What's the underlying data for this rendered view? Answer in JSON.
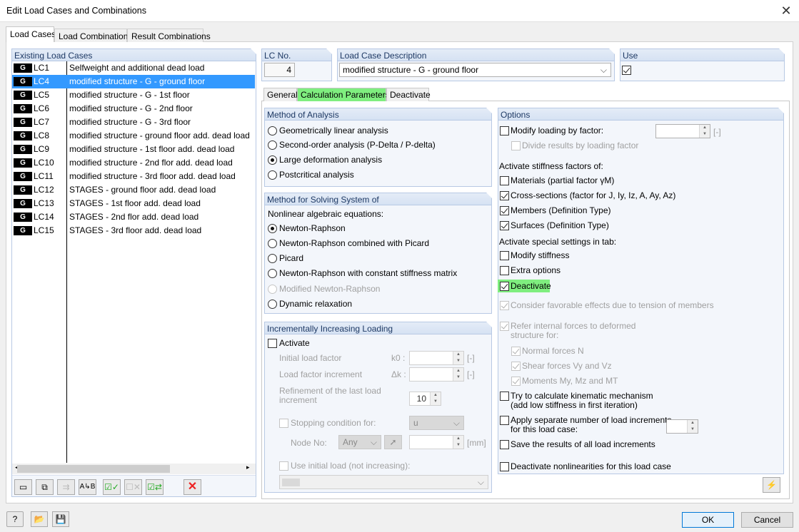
{
  "window": {
    "title": "Edit Load Cases and Combinations",
    "close": "✕"
  },
  "tabs": [
    {
      "label": "Load Cases",
      "selected": true
    },
    {
      "label": "Load Combinations"
    },
    {
      "label": "Result Combinations"
    }
  ],
  "existing": {
    "header": "Existing Load Cases",
    "items": [
      {
        "type": "G",
        "id": "LC1",
        "desc": "Selfweight and additional dead load"
      },
      {
        "type": "G",
        "id": "LC4",
        "desc": "modified structure - G - ground floor",
        "selected": true
      },
      {
        "type": "G",
        "id": "LC5",
        "desc": "modified structure - G - 1st floor"
      },
      {
        "type": "G",
        "id": "LC6",
        "desc": "modified structure - G - 2nd floor"
      },
      {
        "type": "G",
        "id": "LC7",
        "desc": "modified structure - G - 3rd floor"
      },
      {
        "type": "G",
        "id": "LC8",
        "desc": "modified structure - ground floor add. dead load"
      },
      {
        "type": "G",
        "id": "LC9",
        "desc": "modified structure - 1st floor add. dead load"
      },
      {
        "type": "G",
        "id": "LC10",
        "desc": "modified structure - 2nd flor add. dead load"
      },
      {
        "type": "G",
        "id": "LC11",
        "desc": "modified structure - 3rd floor add. dead load"
      },
      {
        "type": "G",
        "id": "LC12",
        "desc": "STAGES  - ground floor add. dead load"
      },
      {
        "type": "G",
        "id": "LC13",
        "desc": "STAGES - 1st floor add. dead load"
      },
      {
        "type": "G",
        "id": "LC14",
        "desc": "STAGES - 2nd flor add. dead load"
      },
      {
        "type": "G",
        "id": "LC15",
        "desc": "STAGES - 3rd floor add. dead load"
      }
    ],
    "toolbar": [
      "new-load-case-icon",
      "copy-load-case-icon",
      "renumber-icon",
      "rename-icon",
      "check-all-icon",
      "uncheck-all-icon",
      "toggle-check-icon",
      "delete-icon"
    ]
  },
  "lcno": {
    "label": "LC No.",
    "value": "4"
  },
  "lcdesc": {
    "label": "Load Case Description",
    "value": "modified structure - G - ground floor"
  },
  "use": {
    "label": "Use",
    "checked": true
  },
  "subtabs": [
    {
      "label": "General"
    },
    {
      "label": "Calculation Parameters",
      "selected": true
    },
    {
      "label": "Deactivate"
    }
  ],
  "analysis": {
    "header": "Method of Analysis",
    "options": [
      {
        "label": "Geometrically linear analysis",
        "on": false
      },
      {
        "label": "Second-order analysis (P-Delta / P-delta)",
        "on": false
      },
      {
        "label": "Large deformation analysis",
        "on": true
      },
      {
        "label": "Postcritical analysis",
        "on": false
      }
    ]
  },
  "solving": {
    "header": "Method for Solving System of",
    "sub": "Nonlinear algebraic equations:",
    "options": [
      {
        "label": "Newton-Raphson",
        "on": true
      },
      {
        "label": "Newton-Raphson combined with Picard",
        "on": false
      },
      {
        "label": "Picard",
        "on": false
      },
      {
        "label": "Newton-Raphson with constant stiffness matrix",
        "on": false
      },
      {
        "label": "Modified Newton-Raphson",
        "on": false,
        "disabled": true
      },
      {
        "label": "Dynamic relaxation",
        "on": false
      }
    ]
  },
  "incremental": {
    "header": "Incrementally Increasing Loading",
    "activate": "Activate",
    "activate_on": false,
    "initial_label": "Initial load factor",
    "initial_sym": "k0 :",
    "initial_unit": "[-]",
    "increment_label": "Load factor increment",
    "increment_sym": "Δk :",
    "increment_unit": "[-]",
    "refine_label1": "Refinement of the last load",
    "refine_label2": "increment",
    "refine_value": "10",
    "stopping_label": "Stopping condition for:",
    "stopping_value": "u",
    "node_label": "Node No:",
    "node_value": "Any",
    "node_unit": "[mm]",
    "initial_load_label": "Use initial load (not increasing):"
  },
  "options": {
    "header": "Options",
    "modify_factor": "Modify loading by factor:",
    "modify_factor_unit": "[-]",
    "divide": "Divide results by loading factor",
    "stiff_head": "Activate stiffness factors of:",
    "materials": "Materials (partial factor γM)",
    "cross": "Cross-sections (factor for J, Iy, Iz, A, Ay, Az)",
    "members": "Members (Definition Type)",
    "surfaces": "Surfaces (Definition Type)",
    "special_head": "Activate special settings in tab:",
    "modify_stiffness": "Modify stiffness",
    "extra": "Extra options",
    "deactivate": "Deactivate",
    "favorable": "Consider favorable effects due to tension of members",
    "refer1": "Refer internal forces to deformed",
    "refer2": "structure for:",
    "normal": "Normal forces N",
    "shear": "Shear forces Vy and Vz",
    "moments": "Moments My, Mz and MT",
    "kin1": "Try to calculate kinematic mechanism",
    "kin2": "(add low stiffness in first iteration)",
    "apply1": "Apply separate number of load increments",
    "apply2": "for this load case:",
    "save": "Save the results of all load increments",
    "nonlin": "Deactivate nonlinearities for this load case"
  },
  "footer": {
    "ok": "OK",
    "cancel": "Cancel"
  }
}
